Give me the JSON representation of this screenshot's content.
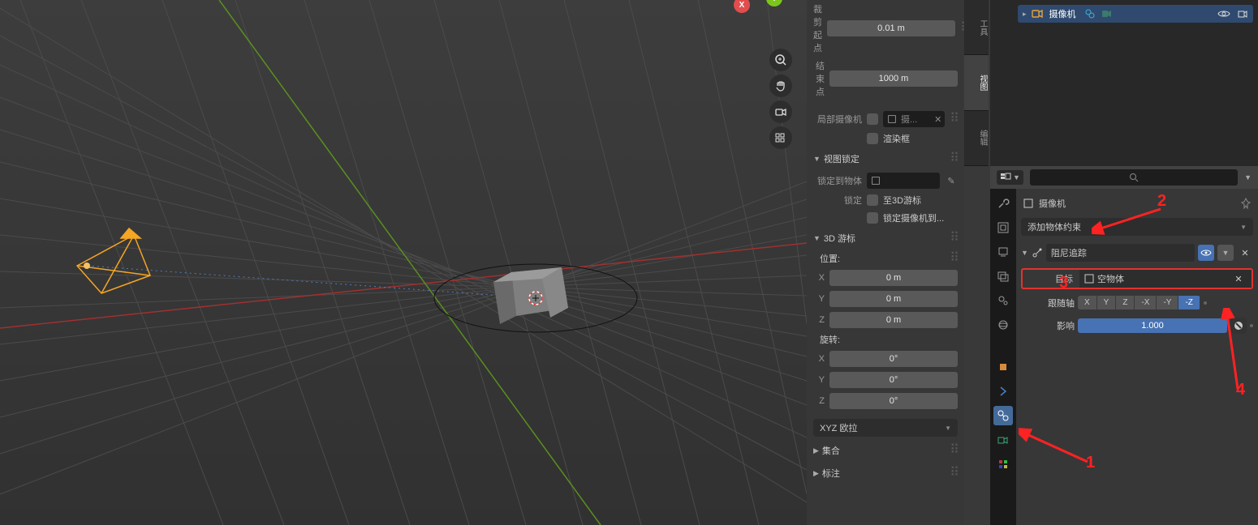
{
  "nav_gizmo": {
    "x": "X",
    "y": "Y"
  },
  "n_panel": {
    "clip_start_label": "裁剪起点",
    "clip_start_value": "0.01 m",
    "clip_end_label": "结束点",
    "clip_end_value": "1000 m",
    "local_camera_label": "局部摄像机",
    "local_camera_value": "摄...",
    "render_border": "渲染框",
    "view_lock_section": "视图锁定",
    "lock_to_object_label": "锁定到物体",
    "lock_label": "锁定",
    "lock_to_cursor": "至3D游标",
    "lock_camera": "锁定摄像机到...",
    "cursor_section": "3D 游标",
    "position_label": "位置:",
    "rotation_label": "旋转:",
    "axes": {
      "x": "X",
      "y": "Y",
      "z": "Z"
    },
    "pos_val": "0 m",
    "rot_val": "0°",
    "rotation_mode": "XYZ 欧拉",
    "collection_section": "集合",
    "annotation_section": "标注"
  },
  "side_tabs": {
    "t1": "工具",
    "t2": "视图",
    "t3": "编辑"
  },
  "outliner": {
    "camera": "摄像机"
  },
  "search_placeholder": "",
  "props": {
    "breadcrumb_icon_alt": "object",
    "breadcrumb": "摄像机",
    "add_constraint": "添加物体约束",
    "constraint_name": "阻尼追踪",
    "target_label": "目标",
    "target_value": "空物体",
    "track_axis_label": "跟随轴",
    "axes": {
      "x": "X",
      "y": "Y",
      "z": "Z",
      "nx": "-X",
      "ny": "-Y",
      "nz": "-Z"
    },
    "influence_label": "影响",
    "influence_value": "1.000"
  },
  "annotations": {
    "a1": "1",
    "a2": "2",
    "a3": "3",
    "a4": "4"
  }
}
